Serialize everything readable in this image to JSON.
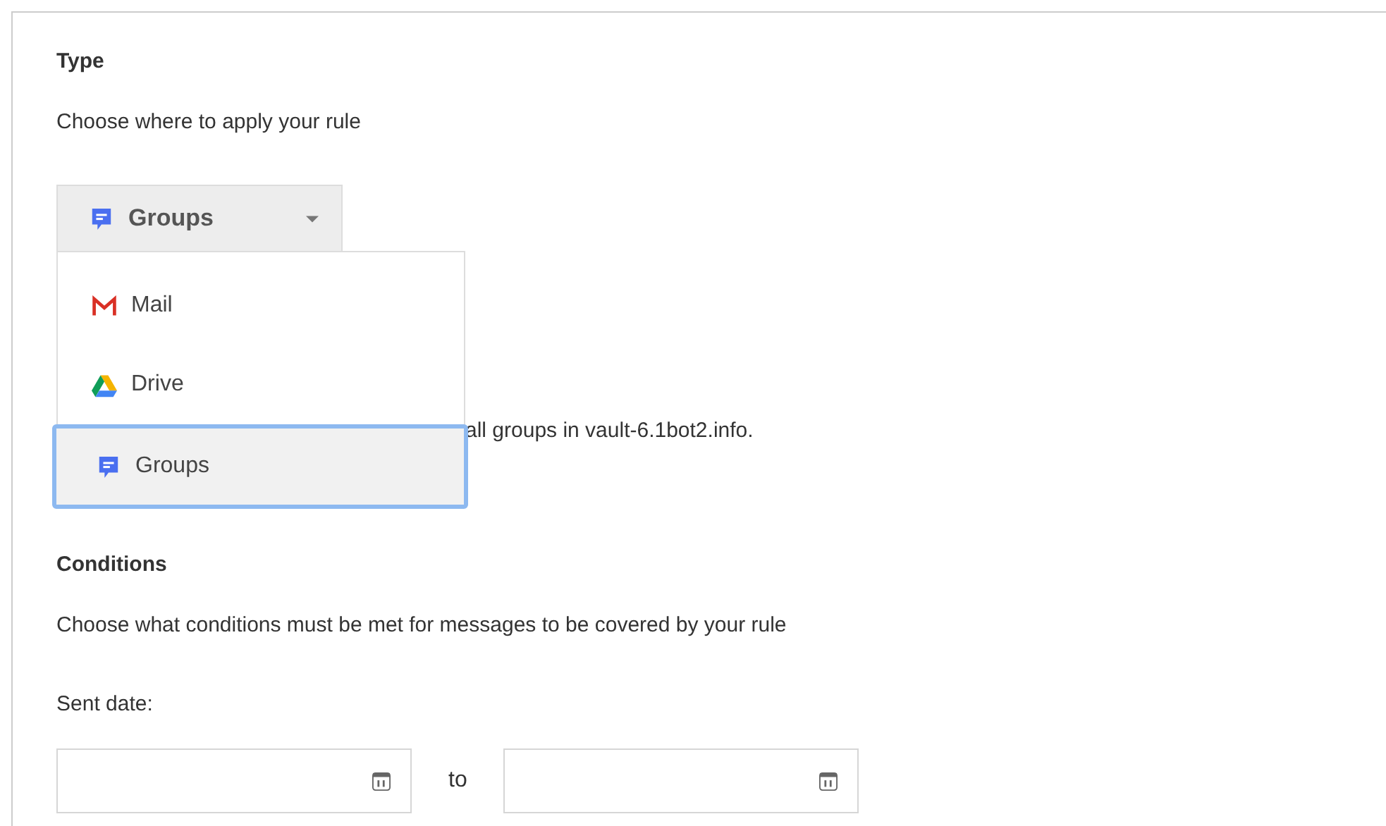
{
  "type_section": {
    "title": "Type",
    "description": "Choose where to apply your rule",
    "dropdown": {
      "value": "Groups",
      "expanded": true
    },
    "options": [
      {
        "label": "Mail",
        "kind": "mail",
        "selected": false
      },
      {
        "label": "Drive",
        "kind": "drive",
        "selected": false
      },
      {
        "label": "Groups",
        "kind": "groups",
        "selected": true
      }
    ],
    "scope_text": "all groups in vault-6.1bot2.info."
  },
  "conditions": {
    "title": "Conditions",
    "description": "Choose what conditions must be met for messages to be covered by your rule",
    "sent_date_label": "Sent date:",
    "separator": "to"
  }
}
